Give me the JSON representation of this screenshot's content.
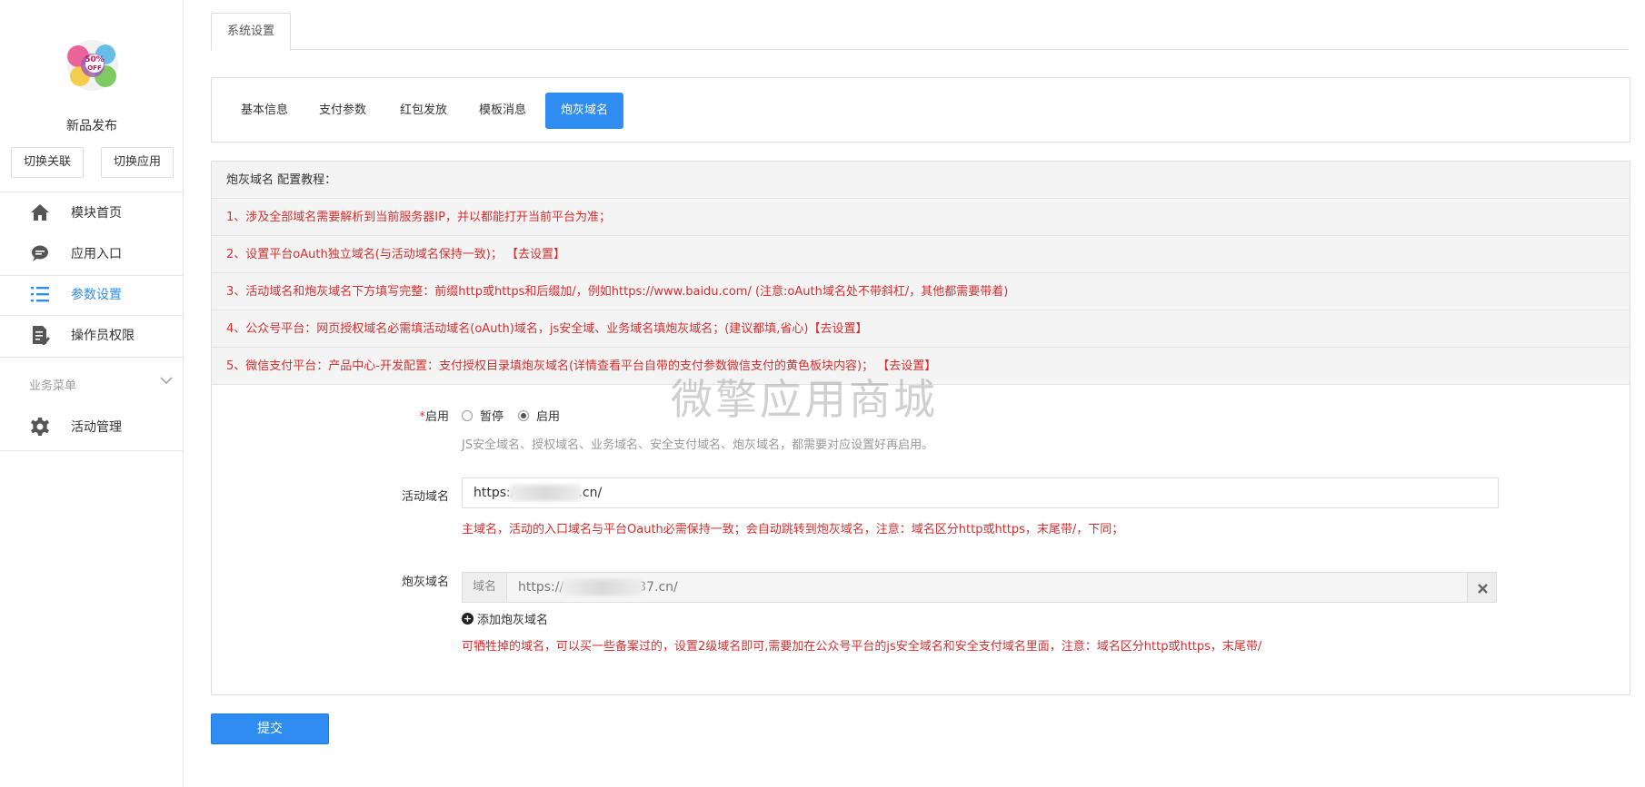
{
  "sidebar": {
    "app_name": "新品发布",
    "switch_link_label": "切换关联",
    "switch_app_label": "切换应用",
    "items": [
      {
        "label": "模块首页",
        "icon": "home-icon"
      },
      {
        "label": "应用入口",
        "icon": "chat-bubble-icon"
      },
      {
        "label": "参数设置",
        "icon": "list-icon"
      },
      {
        "label": "操作员权限",
        "icon": "document-edit-icon"
      }
    ],
    "group_title": "业务菜单",
    "group_items": [
      {
        "label": "活动管理",
        "icon": "gear-icon"
      }
    ],
    "active_color": "#2f8cf0"
  },
  "header": {
    "tab_label": "系统设置"
  },
  "subtabs": [
    {
      "label": "基本信息"
    },
    {
      "label": "支付参数"
    },
    {
      "label": "红包发放"
    },
    {
      "label": "模板消息"
    },
    {
      "label": "炮灰域名",
      "active": true
    }
  ],
  "tips": {
    "heading": "炮灰域名 配置教程：",
    "lines": [
      "1、涉及全部域名需要解析到当前服务器IP，并以都能打开当前平台为准；",
      "2、设置平台oAuth独立域名(与活动域名保持一致)； 【去设置】",
      "3、活动域名和炮灰域名下方填写完整：前缀http或https和后缀加/，例如https://www.baidu.com/ (注意:oAuth域名处不带斜杠/，其他都需要带着)",
      "4、公众号平台：网页授权域名必需填活动域名(oAuth)域名，js安全域、业务域名填炮灰域名；(建议都填,省心)【去设置】",
      "5、微信支付平台：产品中心-开发配置：支付授权目录填炮灰域名(详情查看平台自带的支付参数微信支付的黄色板块内容)； 【去设置】"
    ]
  },
  "form": {
    "enable_label": "启用",
    "required_mark": "*",
    "radio_pause": "暂停",
    "radio_enable": "启用",
    "enable_help": "JS安全域名、授权域名、业务域名、安全支付域名、炮灰域名，都需要对应设置好再启用。",
    "activity_domain_label": "活动域名",
    "activity_domain_prefix": "https:/",
    "activity_domain_suffix": ".cn/",
    "activity_domain_help": "主域名，活动的入口域名与平台Oauth必需保持一致；会自动跳转到炮灰域名，注意：域名区分http或https，末尾带/，下同；",
    "cannon_domain_label": "炮灰域名",
    "cannon_addon": "域名",
    "cannon_prefix": "https://",
    "cannon_suffix": "37.cn/",
    "add_cannon_label": "添加炮灰域名",
    "cannon_help": "可牺牲掉的域名，可以买一些备案过的，设置2级域名即可,需要加在公众号平台的js安全域名和安全支付域名里面，注意：域名区分http或https，末尾带/"
  },
  "watermark": "微擎应用商城",
  "submit_label": "提交"
}
